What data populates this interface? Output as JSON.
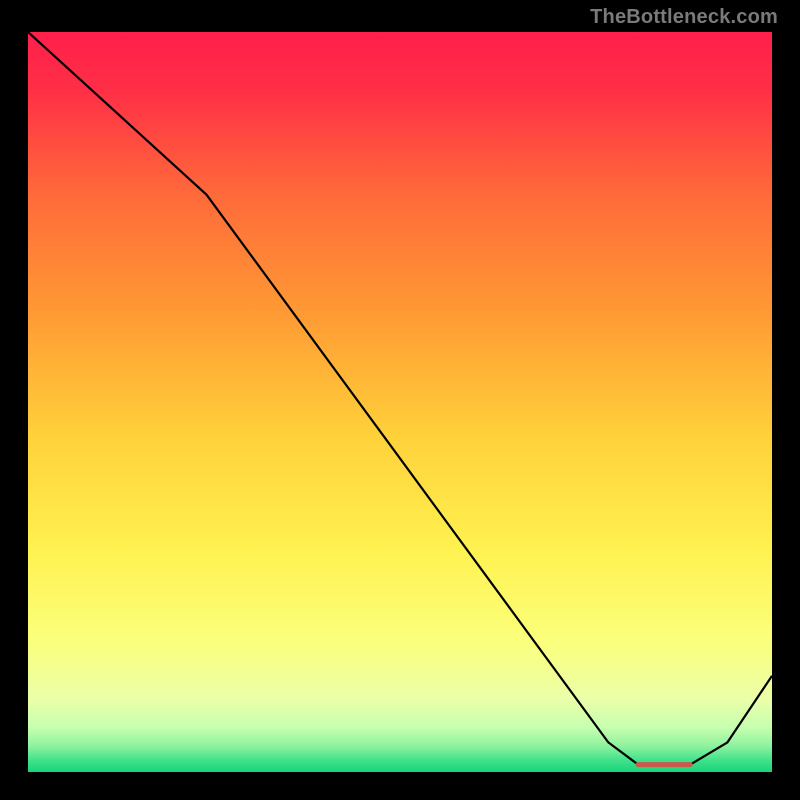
{
  "watermark": "TheBottleneck.com",
  "chart_data": {
    "type": "line",
    "title": "",
    "xlabel": "",
    "ylabel": "",
    "xlim": [
      0,
      100
    ],
    "ylim": [
      0,
      100
    ],
    "series": [
      {
        "name": "curve",
        "x": [
          0,
          24,
          78,
          82,
          89,
          94,
          100
        ],
        "y": [
          100,
          78,
          4,
          1,
          1,
          4,
          13
        ]
      }
    ],
    "optimal_segment": {
      "x_start": 82,
      "x_end": 89,
      "y": 1
    },
    "optimal_marker_color": "#c75a4a",
    "gradient_stops": [
      {
        "offset": 0.0,
        "color": "#ff1f4b"
      },
      {
        "offset": 0.08,
        "color": "#ff2f46"
      },
      {
        "offset": 0.22,
        "color": "#ff6a3a"
      },
      {
        "offset": 0.38,
        "color": "#ff9a34"
      },
      {
        "offset": 0.55,
        "color": "#ffd23a"
      },
      {
        "offset": 0.7,
        "color": "#fff250"
      },
      {
        "offset": 0.82,
        "color": "#fbff7a"
      },
      {
        "offset": 0.9,
        "color": "#ecffa8"
      },
      {
        "offset": 0.94,
        "color": "#c6ffb0"
      },
      {
        "offset": 0.965,
        "color": "#8ef29e"
      },
      {
        "offset": 0.985,
        "color": "#3fe08a"
      },
      {
        "offset": 1.0,
        "color": "#17d47c"
      }
    ]
  }
}
